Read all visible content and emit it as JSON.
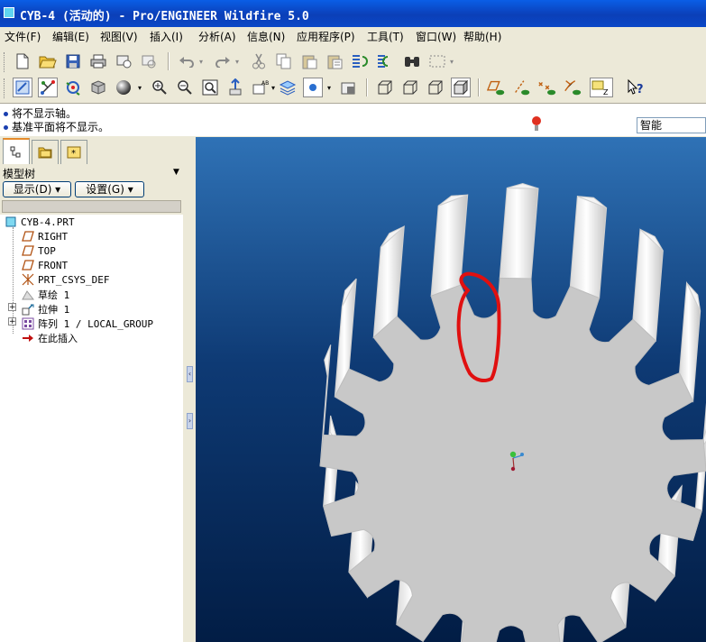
{
  "window": {
    "title": "CYB-4 (活动的) - Pro/ENGINEER Wildfire 5.0"
  },
  "menu": [
    {
      "label": "文件(F)"
    },
    {
      "label": "编辑(E)"
    },
    {
      "label": "视图(V)"
    },
    {
      "label": "插入(I)"
    },
    {
      "label": "分析(A)"
    },
    {
      "label": "信息(N)"
    },
    {
      "label": "应用程序(P)"
    },
    {
      "label": "工具(T)"
    },
    {
      "label": "窗口(W)"
    },
    {
      "label": "帮助(H)"
    }
  ],
  "messages": [
    {
      "text": "将不显示轴。"
    },
    {
      "text": "基准平面将不显示。"
    }
  ],
  "filter": {
    "value": "智能"
  },
  "model_tree": {
    "title": "模型树",
    "show_button": "显示(D) ▾",
    "settings_button": "设置(G) ▾",
    "items": [
      {
        "label": "CYB-4.PRT",
        "icon": "part-icon"
      },
      {
        "label": "RIGHT",
        "icon": "datum-plane-icon"
      },
      {
        "label": "TOP",
        "icon": "datum-plane-icon"
      },
      {
        "label": "FRONT",
        "icon": "datum-plane-icon"
      },
      {
        "label": "PRT_CSYS_DEF",
        "icon": "csys-icon"
      },
      {
        "label": "草绘 1",
        "icon": "sketch-icon"
      },
      {
        "label": "拉伸 1",
        "icon": "extrude-icon"
      },
      {
        "label": "阵列 1 / LOCAL_GROUP",
        "icon": "pattern-icon"
      },
      {
        "label": "在此插入",
        "icon": "insert-here-arrow-icon"
      }
    ]
  },
  "colors": {
    "titlebar": "#0b46c8",
    "viewport_top": "#2f72b6",
    "viewport_bottom": "#021d45",
    "gear": "#c8c8c8",
    "annotation": "#e01010"
  }
}
